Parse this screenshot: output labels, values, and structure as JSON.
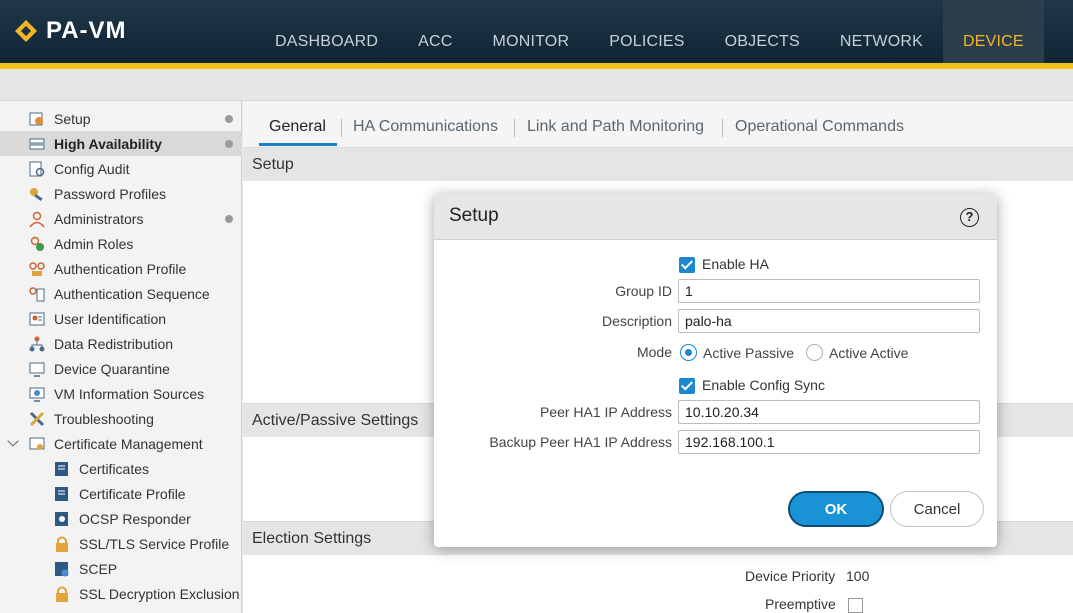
{
  "app": {
    "title": "PA-VM",
    "nav": [
      {
        "label": "DASHBOARD"
      },
      {
        "label": "ACC"
      },
      {
        "label": "MONITOR"
      },
      {
        "label": "POLICIES"
      },
      {
        "label": "OBJECTS"
      },
      {
        "label": "NETWORK"
      },
      {
        "label": "DEVICE"
      }
    ],
    "active_nav": "DEVICE",
    "accent_color": "#f0c21b"
  },
  "sidebar": {
    "items": [
      {
        "label": "Setup",
        "icon": "setup-icon"
      },
      {
        "label": "High Availability",
        "icon": "high-availability-icon"
      },
      {
        "label": "Config Audit",
        "icon": "config-audit-icon"
      },
      {
        "label": "Password Profiles",
        "icon": "key-icon"
      },
      {
        "label": "Administrators",
        "icon": "user-icon"
      },
      {
        "label": "Admin Roles",
        "icon": "admin-role-icon"
      },
      {
        "label": "Authentication Profile",
        "icon": "auth-profile-icon"
      },
      {
        "label": "Authentication Sequence",
        "icon": "auth-sequence-icon"
      },
      {
        "label": "User Identification",
        "icon": "user-id-icon"
      },
      {
        "label": "Data Redistribution",
        "icon": "network-tree-icon"
      },
      {
        "label": "Device Quarantine",
        "icon": "monitor-icon"
      },
      {
        "label": "VM Information Sources",
        "icon": "vm-icon"
      },
      {
        "label": "Troubleshooting",
        "icon": "wrench-icon"
      },
      {
        "label": "Certificate Management",
        "icon": "certificate-icon"
      },
      {
        "label": "Certificates",
        "icon": "certificate-icon"
      },
      {
        "label": "Certificate Profile",
        "icon": "certificate-icon"
      },
      {
        "label": "OCSP Responder",
        "icon": "certificate-icon"
      },
      {
        "label": "SSL/TLS Service Profile",
        "icon": "lock-icon"
      },
      {
        "label": "SCEP",
        "icon": "scep-icon"
      },
      {
        "label": "SSL Decryption Exclusion",
        "icon": "lock-icon"
      }
    ]
  },
  "main": {
    "tabs": [
      {
        "label": "General"
      },
      {
        "label": "HA Communications"
      },
      {
        "label": "Link and Path Monitoring"
      },
      {
        "label": "Operational Commands"
      }
    ],
    "sections": {
      "setup": "Setup",
      "active_passive": "Active/Passive Settings",
      "election": "Election Settings"
    },
    "election": {
      "device_priority_label": "Device Priority",
      "device_priority_value": "100",
      "preemptive_label": "Preemptive"
    }
  },
  "modal": {
    "title": "Setup",
    "help": "?",
    "enable_ha_label": "Enable HA",
    "group_id_label": "Group ID",
    "group_id_value": "1",
    "description_label": "Description",
    "description_value": "palo-ha",
    "mode_label": "Mode",
    "mode_options": [
      "Active Passive",
      "Active Active"
    ],
    "mode_selected": "Active Passive",
    "config_sync_label": "Enable Config Sync",
    "peer_ha1_label": "Peer HA1 IP Address",
    "peer_ha1_value": "10.10.20.34",
    "backup_peer_ha1_label": "Backup Peer HA1 IP Address",
    "backup_peer_ha1_value": "192.168.100.1",
    "ok_label": "OK",
    "cancel_label": "Cancel"
  }
}
